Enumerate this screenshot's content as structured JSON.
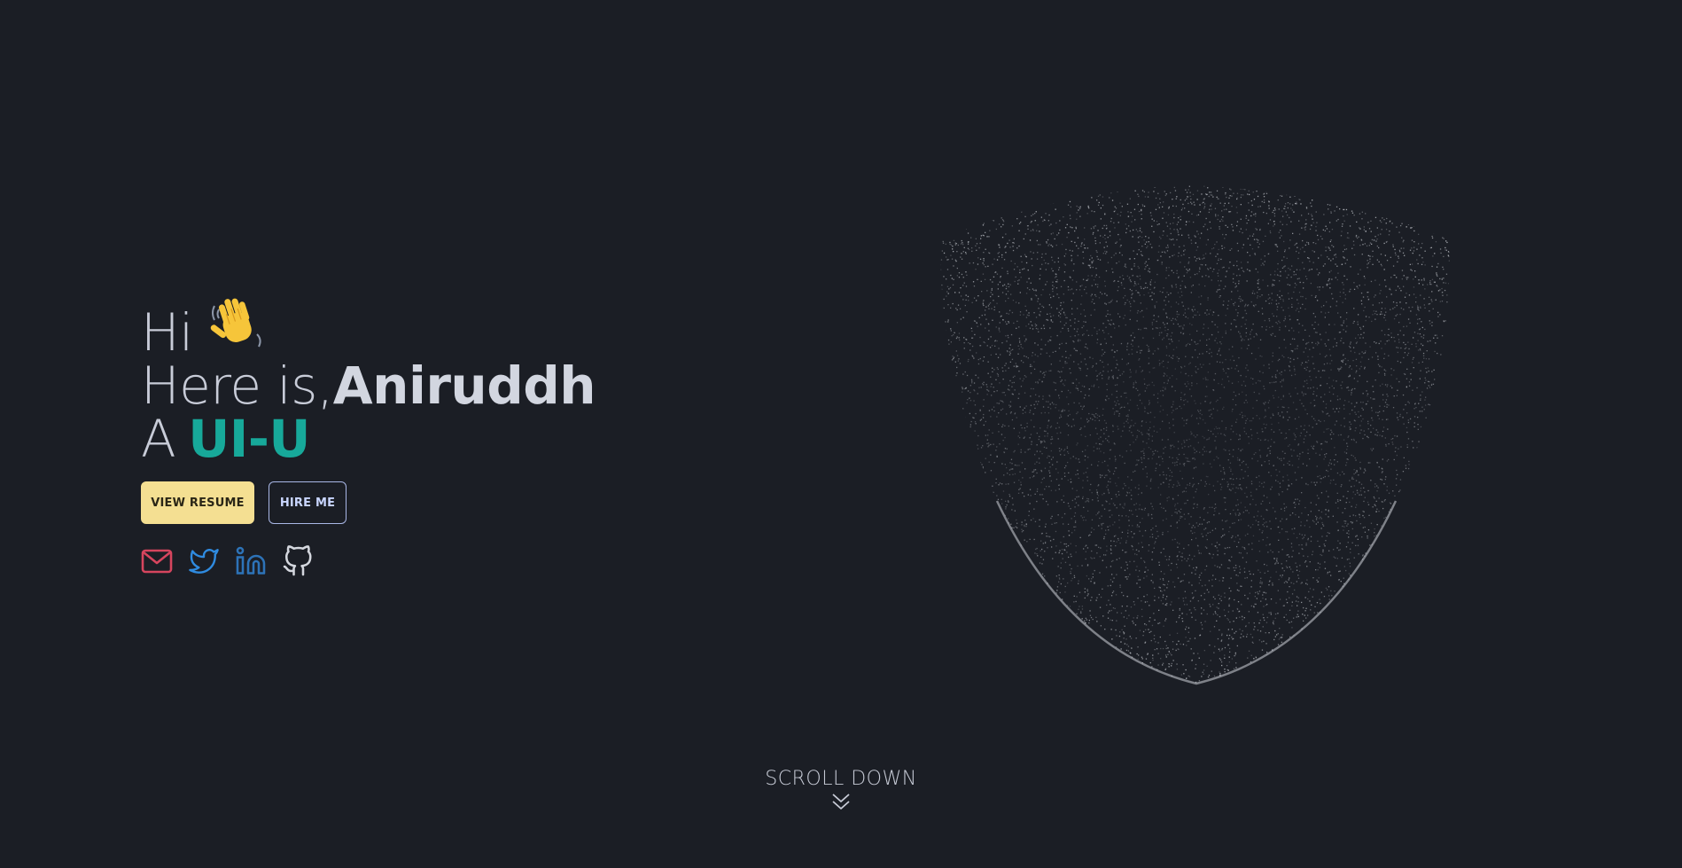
{
  "hero": {
    "greeting": "Hi",
    "intro": "Here is,",
    "name": "Aniruddh",
    "role_prefix": "A",
    "role": "UI-U"
  },
  "icons": {
    "wave": "waving-hand-icon",
    "email": "email-icon",
    "twitter": "twitter-icon",
    "linkedin": "linkedin-icon",
    "github": "github-icon",
    "scroll": "double-chevron-down-icon"
  },
  "buttons": {
    "resume_label": "VIEW RESUME",
    "hire_label": "HIRE ME"
  },
  "scroll": {
    "label": "SCROLL DOWN"
  },
  "colors": {
    "background": "#1b1e25",
    "accent": "#17a99a",
    "resume_button": "#f4df92",
    "email_icon": "#d6455e",
    "twitter_icon": "#2f8be0",
    "linkedin_icon": "#2d73b8",
    "github_icon": "#d4d7de"
  }
}
